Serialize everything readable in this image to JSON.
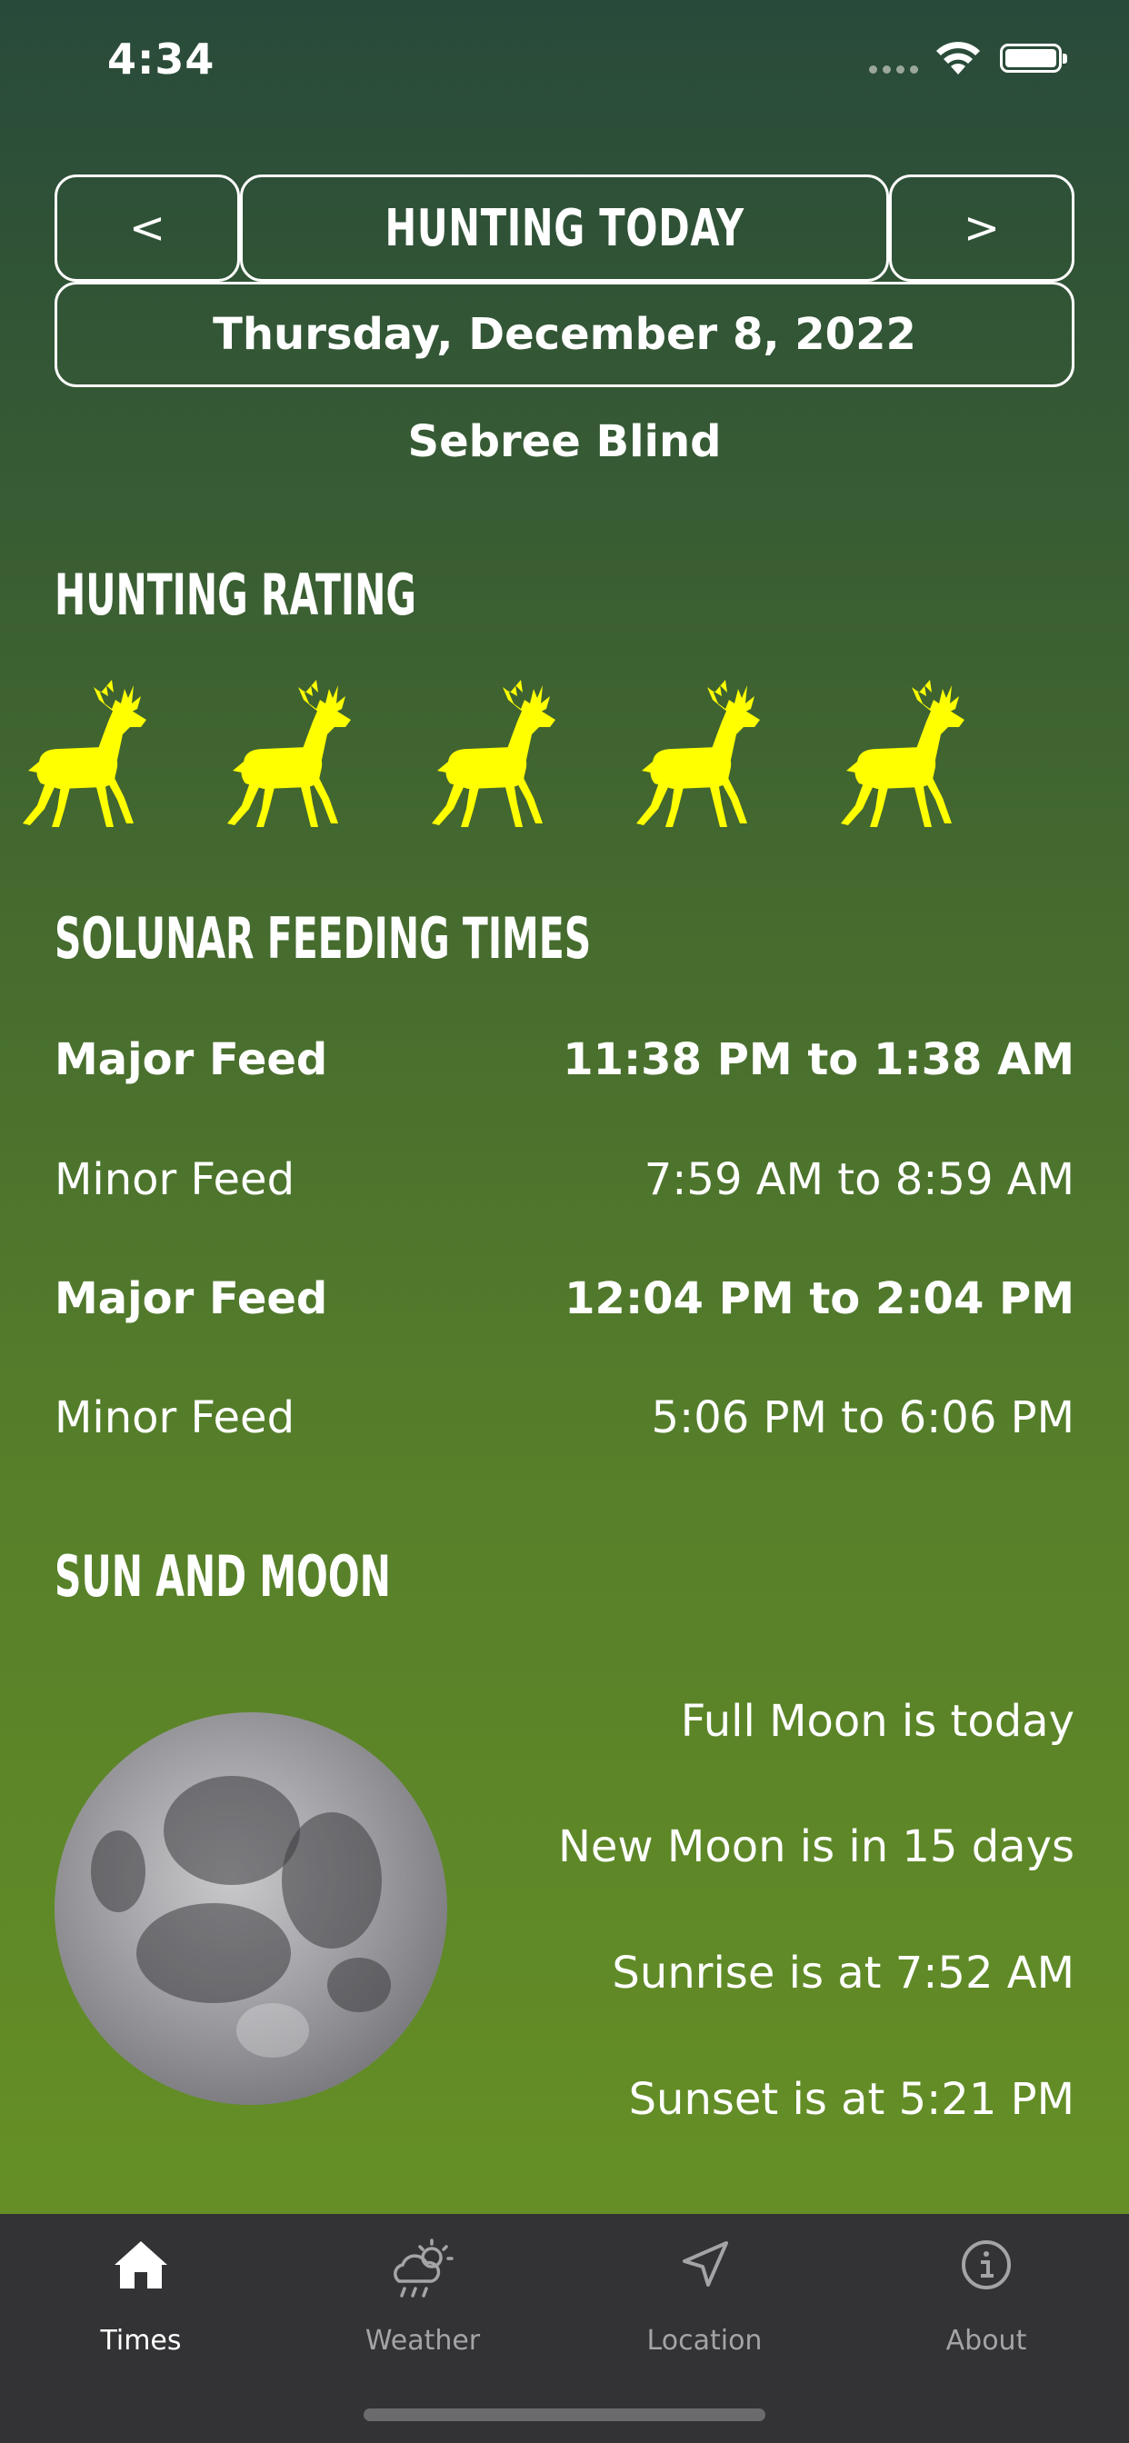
{
  "status_bar": {
    "time": "4:34"
  },
  "nav": {
    "prev_label": "<",
    "title": "HUNTING TODAY",
    "next_label": ">"
  },
  "date": "Thursday, December 8, 2022",
  "location_name": "Sebree Blind",
  "rating": {
    "heading": "HUNTING RATING",
    "value": 5,
    "max": 5,
    "icon": "deer-icon",
    "icon_color": "#ffff00"
  },
  "feeding": {
    "heading": "SOLUNAR FEEDING TIMES",
    "rows": [
      {
        "label": "Major Feed",
        "time": "11:38 PM to 1:38 AM",
        "major": true
      },
      {
        "label": "Minor Feed",
        "time": "7:59 AM to 8:59 AM",
        "major": false
      },
      {
        "label": "Major Feed",
        "time": "12:04 PM to 2:04 PM",
        "major": true
      },
      {
        "label": "Minor Feed",
        "time": "5:06 PM to 6:06 PM",
        "major": false
      }
    ]
  },
  "sun_moon": {
    "heading": "SUN AND MOON",
    "lines": [
      "Full Moon is today",
      "New Moon is in 15 days",
      "Sunrise is at 7:52 AM",
      "Sunset is at 5:21 PM"
    ]
  },
  "tabs": [
    {
      "label": "Times",
      "icon": "home-icon",
      "active": true
    },
    {
      "label": "Weather",
      "icon": "weather-icon",
      "active": false
    },
    {
      "label": "Location",
      "icon": "location-arrow-icon",
      "active": false
    },
    {
      "label": "About",
      "icon": "info-icon",
      "active": false
    }
  ],
  "colors": {
    "bg_top": "#284a3a",
    "bg_bottom": "#6a9424",
    "tabbar": "#333335",
    "deer": "#ffff00"
  }
}
